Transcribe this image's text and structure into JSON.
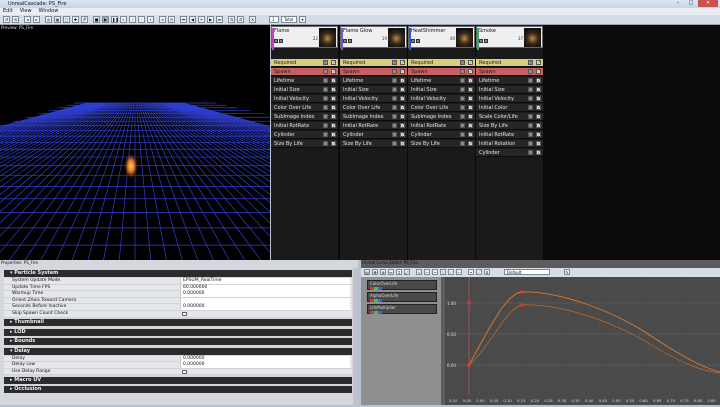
{
  "window": {
    "title": "UnrealCascade: PS_Fire"
  },
  "menu": [
    "Edit",
    "View",
    "Window"
  ],
  "toolbar": {
    "lod_value": "1",
    "lod_label": "Total"
  },
  "preview": {
    "caption": "Preview: PS_Fire"
  },
  "emitters": [
    {
      "name": "Flame",
      "count": "22",
      "stripe": "#c640c6",
      "modules": [
        {
          "label": "Required",
          "kind": "req"
        },
        {
          "label": "Spawn",
          "kind": "spawn"
        },
        {
          "label": "Lifetime"
        },
        {
          "label": "Initial Size"
        },
        {
          "label": "Initial Velocity"
        },
        {
          "label": "Color Over Life"
        },
        {
          "label": "SubImage Index"
        },
        {
          "label": "Initial RotRate"
        },
        {
          "label": "Cylinder"
        },
        {
          "label": "Size By Life"
        }
      ]
    },
    {
      "name": "Flame Glow",
      "count": "19",
      "stripe": "#7a57c8",
      "modules": [
        {
          "label": "Required",
          "kind": "req"
        },
        {
          "label": "Spawn",
          "kind": "spawn"
        },
        {
          "label": "Lifetime"
        },
        {
          "label": "Initial Size"
        },
        {
          "label": "Initial Velocity"
        },
        {
          "label": "Color Over Life"
        },
        {
          "label": "SubImage Index"
        },
        {
          "label": "Initial RotRate"
        },
        {
          "label": "Cylinder"
        },
        {
          "label": "Size By Life"
        }
      ]
    },
    {
      "name": "HeatShimmer",
      "count": "40",
      "stripe": "#3a55c8",
      "modules": [
        {
          "label": "Required",
          "kind": "req"
        },
        {
          "label": "Spawn",
          "kind": "spawn"
        },
        {
          "label": "Lifetime"
        },
        {
          "label": "Initial Size"
        },
        {
          "label": "Initial Velocity"
        },
        {
          "label": "Color Over Life"
        },
        {
          "label": "SubImage Index"
        },
        {
          "label": "Initial RotRate"
        },
        {
          "label": "Cylinder"
        },
        {
          "label": "Size By Life"
        }
      ]
    },
    {
      "name": "Smoke",
      "count": "37",
      "stripe": "#3aa86a",
      "modules": [
        {
          "label": "Required",
          "kind": "req"
        },
        {
          "label": "Spawn",
          "kind": "spawn"
        },
        {
          "label": "Lifetime"
        },
        {
          "label": "Initial Size"
        },
        {
          "label": "Initial Velocity"
        },
        {
          "label": "Initial Color"
        },
        {
          "label": "Scale Color/Life"
        },
        {
          "label": "Size By Life"
        },
        {
          "label": "Initial RotRate"
        },
        {
          "label": "Initial Rotation"
        },
        {
          "label": "Cylinder"
        }
      ]
    }
  ],
  "properties": {
    "caption": "Properties: PS_Fire",
    "sections": [
      {
        "title": "Particle System",
        "open": true,
        "rows": [
          {
            "key": "System Update Mode",
            "value": "EPSUM_RealTime"
          },
          {
            "key": "Update Time FPS",
            "value": "60.000000"
          },
          {
            "key": "Warmup Time",
            "value": "0.000000"
          },
          {
            "key": "Orient ZAxis Toward Camera",
            "value": ""
          },
          {
            "key": "Seconds Before Inactive",
            "value": "0.000000"
          },
          {
            "key": "Skip Spawn Count Check",
            "value": "",
            "checkbox": true
          }
        ]
      },
      {
        "title": "Thumbnail",
        "open": false,
        "rows": []
      },
      {
        "title": "LOD",
        "open": false,
        "rows": []
      },
      {
        "title": "Bounds",
        "open": false,
        "rows": []
      },
      {
        "title": "Delay",
        "open": true,
        "rows": [
          {
            "key": "Delay",
            "value": "0.000000"
          },
          {
            "key": "Delay Low",
            "value": "0.000000"
          },
          {
            "key": "Use Delay Range",
            "value": "",
            "checkbox": true
          }
        ]
      },
      {
        "title": "Macro UV",
        "open": false,
        "rows": []
      },
      {
        "title": "Occlusion",
        "open": false,
        "rows": []
      }
    ]
  },
  "curve_editor": {
    "caption": "Unreal Curve Editor: PS_Fire",
    "preset": "Default",
    "tracks": [
      "ColorOverLife",
      "AlphaOverLife",
      "LifeMultiplier"
    ],
    "y_labels": [
      "1.00",
      "0.50",
      "0.00"
    ],
    "x_labels": [
      "0.10",
      "0.05",
      "0.00",
      "0.05",
      "0.10",
      "0.15",
      "0.20",
      "0.25",
      "0.30",
      "0.35",
      "0.40",
      "0.45",
      "0.50",
      "0.55",
      "0.60",
      "0.65",
      "0.70",
      "0.75",
      "0.80",
      "0.85"
    ]
  }
}
